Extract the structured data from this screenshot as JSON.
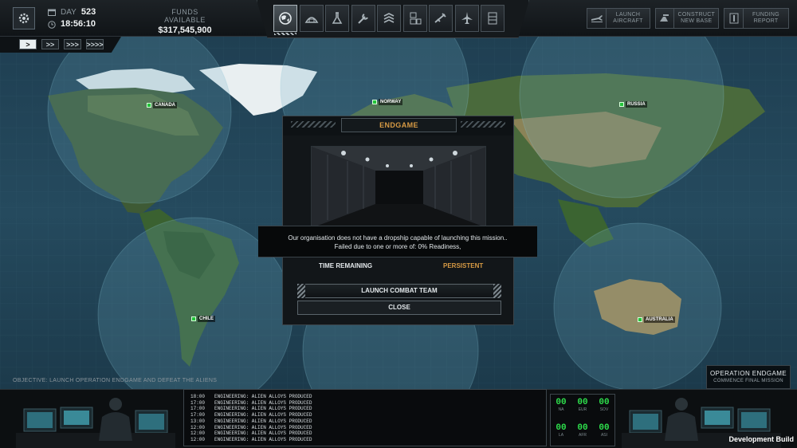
{
  "topbar": {
    "day_label": "DAY",
    "day_value": "523",
    "time_value": "18:56:10",
    "funds_label": "FUNDS AVAILABLE",
    "funds_value": "$317,545,900",
    "modes": [
      "geoscape-icon",
      "hangar-icon",
      "research-icon",
      "engineering-icon",
      "soldiers-icon",
      "stores-icon",
      "weapons-icon",
      "aircraft-icon",
      "bases-icon"
    ],
    "active_mode": 0,
    "actions": [
      {
        "label": "LAUNCH AIRCRAFT",
        "icon": "aircraft-icon"
      },
      {
        "label": "CONSTRUCT NEW BASE",
        "icon": "construct-icon"
      },
      {
        "label": "FUNDING REPORT",
        "icon": "report-icon"
      }
    ]
  },
  "speed": {
    "buttons": [
      ">",
      ">>",
      ">>>",
      ">>>>"
    ],
    "active": 0
  },
  "countries": [
    "CANADA",
    "NORWAY",
    "RUSSIA",
    "CHILE",
    "AUSTRALIA"
  ],
  "objective": "OBJECTIVE: LAUNCH OPERATION ENDGAME AND DEFEAT THE ALIENS",
  "operation": {
    "title": "OPERATION ENDGAME",
    "subtitle": "COMMENCE FINAL MISSION"
  },
  "modal": {
    "title": "ENDGAME",
    "message_line1": "Our organisation does not have a dropship capable of launching this mission..",
    "message_line2": "Failed due to one or more of: 0% Readiness,",
    "time_remaining_label": "TIME REMAINING",
    "time_remaining_value": "PERSISTENT",
    "launch_label": "LAUNCH COMBAT TEAM",
    "close_label": "CLOSE"
  },
  "log": [
    {
      "time": "18:00",
      "text": "ENGINEERING: ALIEN ALLOYS PRODUCED"
    },
    {
      "time": "17:00",
      "text": "ENGINEERING: ALIEN ALLOYS PRODUCED"
    },
    {
      "time": "17:00",
      "text": "ENGINEERING: ALIEN ALLOYS PRODUCED"
    },
    {
      "time": "17:00",
      "text": "ENGINEERING: ALIEN ALLOYS PRODUCED"
    },
    {
      "time": "13:00",
      "text": "ENGINEERING: ALIEN ALLOYS PRODUCED"
    },
    {
      "time": "12:00",
      "text": "ENGINEERING: ALIEN ALLOYS PRODUCED"
    },
    {
      "time": "12:00",
      "text": "ENGINEERING: ALIEN ALLOYS PRODUCED"
    },
    {
      "time": "12:00",
      "text": "ENGINEERING: ALIEN ALLOYS PRODUCED"
    }
  ],
  "counters": [
    {
      "label": "NA",
      "value": "00"
    },
    {
      "label": "EUR",
      "value": "00"
    },
    {
      "label": "SOV",
      "value": "00"
    },
    {
      "label": "LA",
      "value": "00"
    },
    {
      "label": "AFR",
      "value": "00"
    },
    {
      "label": "ASI",
      "value": "00"
    }
  ],
  "dev_build": "Development Build",
  "colors": {
    "accent_orange": "#d79a44",
    "counter_green": "#2ee04c",
    "radar_cyan": "#5fb8c8",
    "ocean": "#24465a"
  }
}
